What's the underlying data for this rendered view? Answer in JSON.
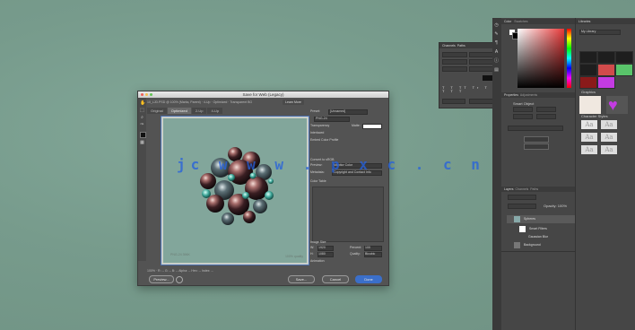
{
  "dialog": {
    "title": "Save for Web (Legacy)",
    "info_bar": "10_LJD.PSD @ 100% (Marks, Parent)  ·  4-Up  ·  Optimized  ·  Transparent BG",
    "learn_button": "Learn More",
    "tabs": [
      "Original",
      "Optimized",
      "2-Up",
      "4-Up"
    ],
    "active_tab": "Optimized",
    "preview_caption_left": "PNG-24\n396K",
    "preview_caption_right": "100% quality",
    "bottom_bar": "100%  ·  R: --  G: --  B: --  Alpha: --  Hex: --  Index: --",
    "settings": {
      "preset_label": "Preset:",
      "preset_value": "[Unnamed]",
      "format": "PNG-24",
      "transparency": "Transparency",
      "matte_label": "Matte:",
      "interlaced": "Interlaced",
      "embed_profile": "Embed Color Profile",
      "convert_srgb": "Convert to sRGB",
      "preview_label": "Preview:",
      "preview_value": "Monitor Color",
      "metadata_label": "Metadata:",
      "metadata_value": "Copyright and Contact Info",
      "color_table": "Color Table",
      "image_size": "Image Size",
      "w_label": "W:",
      "w_value": "1920",
      "h_label": "H:",
      "h_value": "1080",
      "percent_label": "Percent:",
      "percent_value": "100",
      "quality_label": "Quality:",
      "quality_value": "Bicubic",
      "animation": "Animation"
    },
    "buttons": {
      "preview": "Preview...",
      "save": "Save...",
      "cancel": "Cancel",
      "done": "Done"
    }
  },
  "watermark": "jc w w w . p x c . c n",
  "panels": {
    "color_tab": "Color",
    "swatches_tab": "Swatches",
    "channels_tab": "Channels",
    "paths_tab": "Paths",
    "libraries_tab": "Libraries",
    "my_library": "My Library",
    "properties_tab": "Properties",
    "adjustments_tab": "Adjustments",
    "properties_sub": "Smart Object",
    "layers_tab": "Layers",
    "layers_tabs": [
      "Layers",
      "Channels",
      "Paths"
    ],
    "kind_label": "Kind",
    "opacity_label": "Opacity: 100%",
    "layers": [
      "Spheres",
      "Smart Filters",
      "Gaussian Blur",
      "Background"
    ],
    "graphics_label": "Graphics",
    "text_styles_label": "Character Styles",
    "text_sample": "Aa"
  },
  "colors": {
    "desktop": "#7a9e90",
    "dialog_bg": "#535353",
    "panel_bg": "#464646",
    "swatch_red": "#d14b4b",
    "swatch_green": "#59c46a",
    "swatch_pink": "#e05ad8",
    "watermark": "#2662dc"
  }
}
